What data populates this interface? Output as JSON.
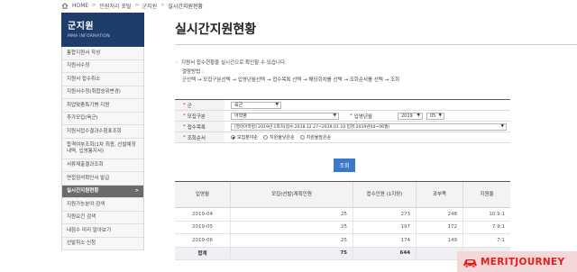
{
  "breadcrumb": {
    "items": [
      "HOME",
      "민원처리 포털",
      "군지원",
      "실시간지원현황"
    ]
  },
  "sidebar": {
    "title": "군지원",
    "subtitle": "MMA INFORMATION",
    "items": [
      {
        "label": "통합지원서 작성"
      },
      {
        "label": "지원서수정"
      },
      {
        "label": "지원서 접수취소"
      },
      {
        "label": "지원서수정(취합승위변경)"
      },
      {
        "label": "취업맞춤특기병 지원"
      },
      {
        "label": "추가모집(육군)"
      },
      {
        "label": "지원서접수결과수험표조회"
      },
      {
        "label": "합격여부조회(1차 최종, 선발예정내역, 입영통지서)"
      },
      {
        "label": "서류제출결과조회"
      },
      {
        "label": "면접점석확인서 발급"
      },
      {
        "label": "실시간지원현황"
      },
      {
        "label": "지원가능분야 검색"
      },
      {
        "label": "지원요건 검색"
      },
      {
        "label": "내점수 미리 알아보기"
      },
      {
        "label": "선발취소 신청"
      }
    ]
  },
  "page": {
    "title": "실시간지원현황"
  },
  "notice": {
    "line1": "지원서 접수현황을 실시간으로 확인할 수 있습니다.",
    "line2": "열람방법 :",
    "line3": "군선택 → 모집구분선택 → 입영년월선택 → 접수목록 선택 → 해당회차를 선택 → 조회순서를 선택 → 조회"
  },
  "form": {
    "army": {
      "label": "군",
      "value": "육군"
    },
    "recruit_type": {
      "label": "모집구분",
      "value": "어학병"
    },
    "enlist_date": {
      "label": "입영년월",
      "year": "2019",
      "month": "05"
    },
    "receipt_list": {
      "label": "접수목록",
      "value": "[영어어학병] 2019년 1회차(접수:2018.12.27~2019.01.10 입영:2019년04~06월)"
    },
    "order": {
      "label": "조회순서",
      "options": [
        {
          "label": "모집분야순",
          "checked": true
        },
        {
          "label": "지원율낮은순",
          "checked": false
        },
        {
          "label": "지원율높은순",
          "checked": false
        }
      ]
    },
    "search_label": "조회"
  },
  "table": {
    "headers": [
      "입영월",
      "모집(선발)계획인원",
      "접수인원 (1지망)",
      "과부족",
      "지원율"
    ],
    "rows": [
      {
        "month": "2019-04",
        "plan": "25",
        "applied": "273",
        "diff": "248",
        "rate": "10.9:1"
      },
      {
        "month": "2019-05",
        "plan": "25",
        "applied": "197",
        "diff": "172",
        "rate": "7.9:1"
      },
      {
        "month": "2019-06",
        "plan": "25",
        "applied": "174",
        "diff": "149",
        "rate": "7:1"
      }
    ],
    "total": {
      "label": "합계",
      "plan": "75",
      "applied": "644",
      "diff": "",
      "rate": ""
    }
  },
  "watermark": {
    "text": "MERITJOURNEY",
    "color": "#e02020"
  }
}
